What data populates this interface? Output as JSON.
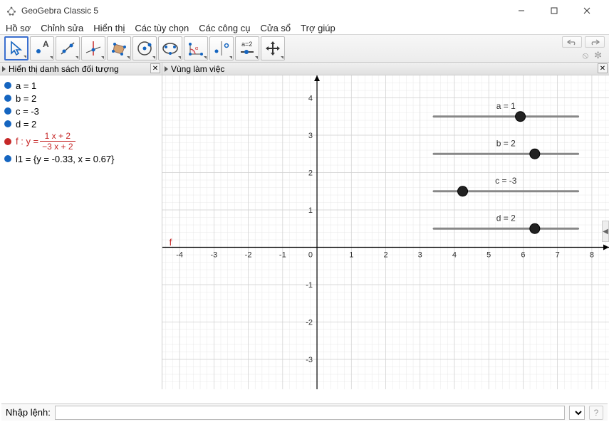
{
  "window": {
    "title": "GeoGebra Classic 5"
  },
  "menu": [
    "Hồ sơ",
    "Chỉnh sửa",
    "Hiển thị",
    "Các tùy chọn",
    "Các công cụ",
    "Cửa sổ",
    "Trợ giúp"
  ],
  "panels": {
    "algebra_title": "Hiển thị danh sách đối tượng",
    "graphics_title": "Vùng làm việc"
  },
  "algebra": {
    "a": "a = 1",
    "b": "b = 2",
    "c": "c = -3",
    "d": "d = 2",
    "f_prefix": "f : y = ",
    "f_num": "1 x + 2",
    "f_den": "−3 x + 2",
    "l1": "l1 = {y = -0.33, x = 0.67}"
  },
  "input": {
    "label": "Nhập lệnh:"
  },
  "sliders": [
    {
      "label": "a = 1",
      "pos": 0.6
    },
    {
      "label": "b = 2",
      "pos": 0.7
    },
    {
      "label": "c = -3",
      "pos": 0.2
    },
    {
      "label": "d = 2",
      "pos": 0.7
    }
  ],
  "chart_data": {
    "type": "line",
    "title": "",
    "xlabel": "",
    "ylabel": "",
    "xlim": [
      -4.5,
      8.5
    ],
    "ylim": [
      -3.8,
      4.6
    ],
    "xticks": [
      -4,
      -3,
      -2,
      -1,
      0,
      1,
      2,
      3,
      4,
      5,
      6,
      7,
      8
    ],
    "yticks": [
      -3,
      -2,
      -1,
      1,
      2,
      3,
      4
    ],
    "function": "f(x) = (1*x + 2) / (-3*x + 2)",
    "vertical_asymptote_x": 0.6667,
    "horizontal_asymptote_y": -0.3333,
    "annotations": [
      {
        "text": "f",
        "x": -4.3,
        "y": 0.05
      }
    ],
    "legend": [],
    "grid": true
  }
}
